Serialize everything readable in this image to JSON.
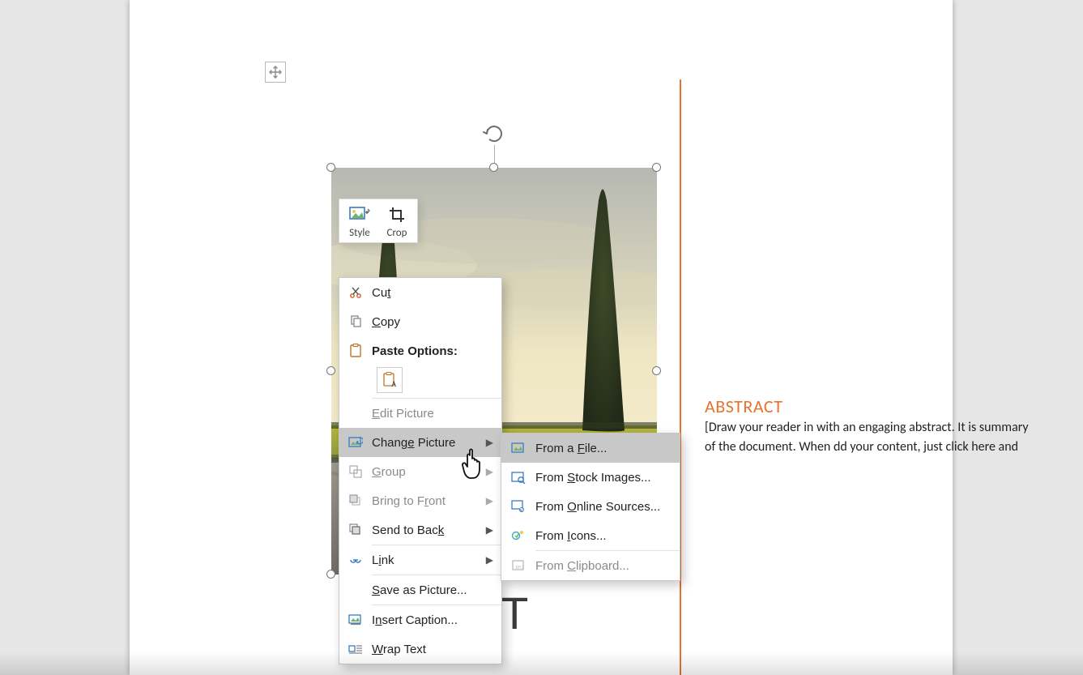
{
  "document": {
    "title_visible": "[DO                     T",
    "abstract_heading": "ABSTRACT",
    "abstract_body": "[Draw your reader in with an engaging abstract. It is                             summary of the document. When                                dd your content, just click here and"
  },
  "mini_toolbar": {
    "style_label": "Style",
    "crop_label": "Crop"
  },
  "context_menu": {
    "cut": "Cut",
    "copy": "Copy",
    "paste_options": "Paste Options:",
    "edit_picture": "Edit Picture",
    "change_picture": "Change Picture",
    "group": "Group",
    "bring_to_front": "Bring to Front",
    "send_to_back": "Send to Back",
    "link": "Link",
    "save_as_picture": "Save as Picture...",
    "insert_caption": "Insert Caption...",
    "wrap_text": "Wrap Text"
  },
  "submenu": {
    "from_file": "From a File...",
    "from_stock": "From Stock Images...",
    "from_online": "From Online Sources...",
    "from_icons": "From Icons...",
    "from_clipboard": "From Clipboard..."
  }
}
